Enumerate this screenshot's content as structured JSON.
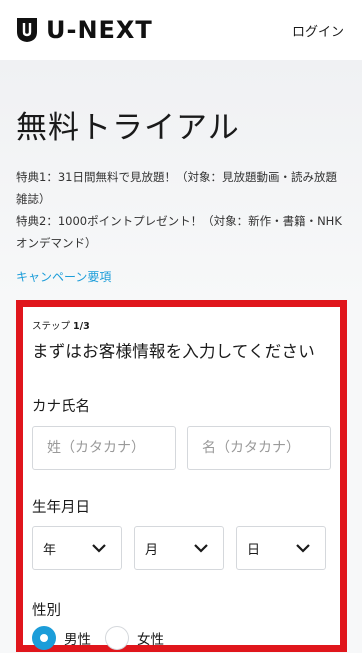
{
  "header": {
    "logo_text": "U-NEXT",
    "login_label": "ログイン"
  },
  "hero": {
    "title": "無料トライアル",
    "benefits": [
      "特典1：31日間無料で見放題！（対象：見放題動画・読み放題雑誌）",
      "特典2：1000ポイントプレゼント！（対象：新作・書籍・NHKオンデマンド）"
    ],
    "campaign_link": "キャンペーン要項"
  },
  "form": {
    "step_label": "ステップ",
    "step_value": "1/3",
    "heading": "まずはお客様情報を入力してください",
    "kana_label": "カナ氏名",
    "last_name_placeholder": "姓（カタカナ）",
    "first_name_placeholder": "名（カタカナ）",
    "dob_label": "生年月日",
    "year_label": "年",
    "month_label": "月",
    "day_label": "日",
    "gender_label": "性別",
    "gender_options": [
      "男性",
      "女性"
    ],
    "gender_selected": "男性"
  },
  "colors": {
    "accent": "#1c9dd9",
    "highlight_border": "#e0161c",
    "brand_text": "#111111"
  },
  "icons": [
    "u-next-logo-icon",
    "chevron-down-icon"
  ]
}
